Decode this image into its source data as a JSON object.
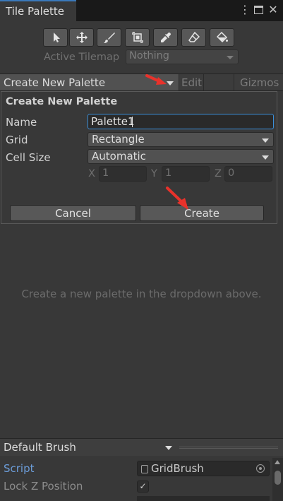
{
  "window": {
    "tab_title": "Tile Palette",
    "menu_icon": "kebab-menu-icon",
    "maximize_icon": "maximize-icon",
    "close_icon": "close-icon",
    "close_glyph": "✕",
    "kebab_glyph": "⋮"
  },
  "tools": [
    {
      "name": "select-tool",
      "icon": "cursor-arrow-icon"
    },
    {
      "name": "move-tool",
      "icon": "move-arrows-icon"
    },
    {
      "name": "paint-tool",
      "icon": "paintbrush-icon"
    },
    {
      "name": "box-fill-tool",
      "icon": "box-fill-icon"
    },
    {
      "name": "picker-tool",
      "icon": "eyedropper-icon"
    },
    {
      "name": "erase-tool",
      "icon": "eraser-icon"
    },
    {
      "name": "flood-fill-tool",
      "icon": "paint-bucket-icon"
    }
  ],
  "active_tilemap": {
    "label": "Active Tilemap",
    "value": "Nothing"
  },
  "palette_bar": {
    "palette_value": "Create New Palette",
    "edit_label": "Edit",
    "gizmos_label": "Gizmos"
  },
  "create_palette": {
    "title": "Create New Palette",
    "name_label": "Name",
    "name_value": "Palette1",
    "grid_label": "Grid",
    "grid_value": "Rectangle",
    "cell_size_label": "Cell Size",
    "cell_size_value": "Automatic",
    "x_label": "X",
    "x_value": "1",
    "y_label": "Y",
    "y_value": "1",
    "z_label": "Z",
    "z_value": "0",
    "cancel_label": "Cancel",
    "create_label": "Create"
  },
  "empty_message": "Create a new palette in the dropdown above.",
  "brush": {
    "value": "Default Brush",
    "script_label": "Script",
    "script_value": "GridBrush",
    "lock_z_label": "Lock Z Position",
    "lock_z_checked": true,
    "check_glyph": "✓"
  },
  "colors": {
    "accent": "#3b8fd9",
    "annotation": "#e8322b",
    "link": "#6c9dd9"
  }
}
